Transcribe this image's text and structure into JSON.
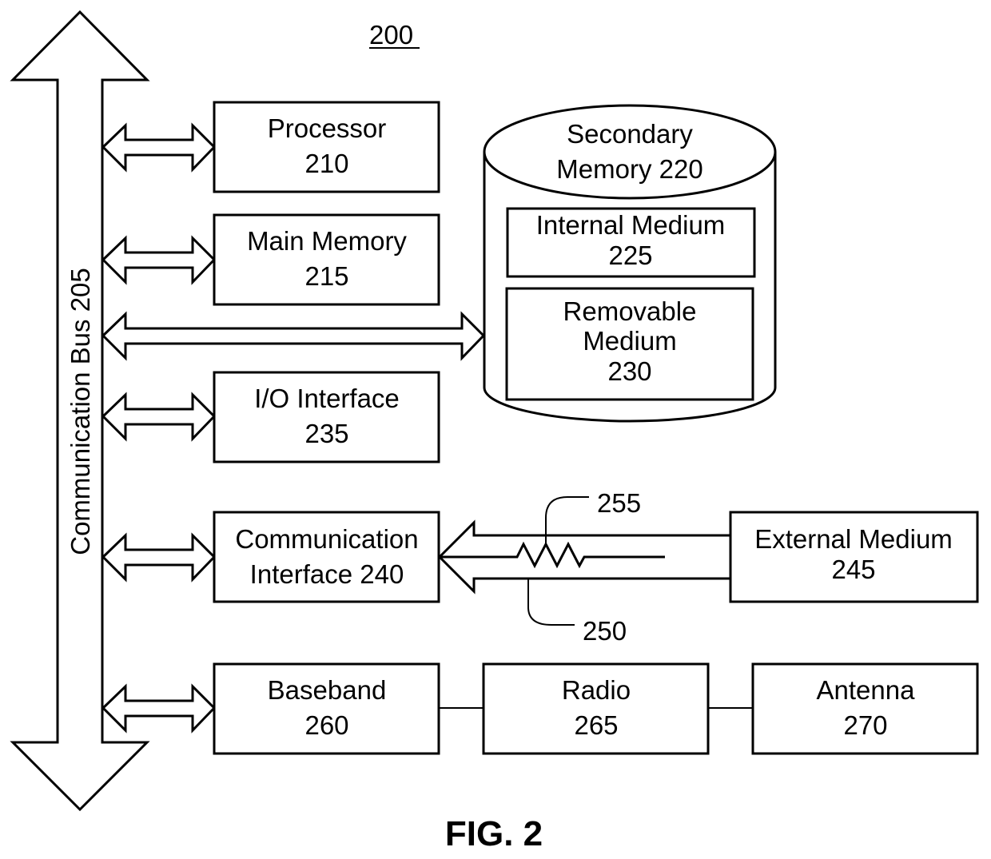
{
  "figure": {
    "number_label": "200",
    "caption": "FIG. 2"
  },
  "bus": {
    "label": "Communication Bus 205"
  },
  "blocks": {
    "processor": {
      "line1": "Processor",
      "line2": "210"
    },
    "main_memory": {
      "line1": "Main Memory",
      "line2": "215"
    },
    "io_interface": {
      "line1": "I/O Interface",
      "line2": "235"
    },
    "comm_interface": {
      "line1": "Communication",
      "line2": "Interface 240"
    },
    "baseband": {
      "line1": "Baseband",
      "line2": "260"
    },
    "radio": {
      "line1": "Radio",
      "line2": "265"
    },
    "antenna": {
      "line1": "Antenna",
      "line2": "270"
    },
    "external_medium": {
      "line1": "External Medium",
      "line2": "245"
    }
  },
  "secondary_memory": {
    "line1": "Secondary",
    "line2": "Memory 220",
    "internal": {
      "line1": "Internal Medium",
      "line2": "225"
    },
    "removable": {
      "line1": "Removable",
      "line2": "Medium",
      "line3": "230"
    }
  },
  "callouts": {
    "signal": "255",
    "channel": "250"
  }
}
